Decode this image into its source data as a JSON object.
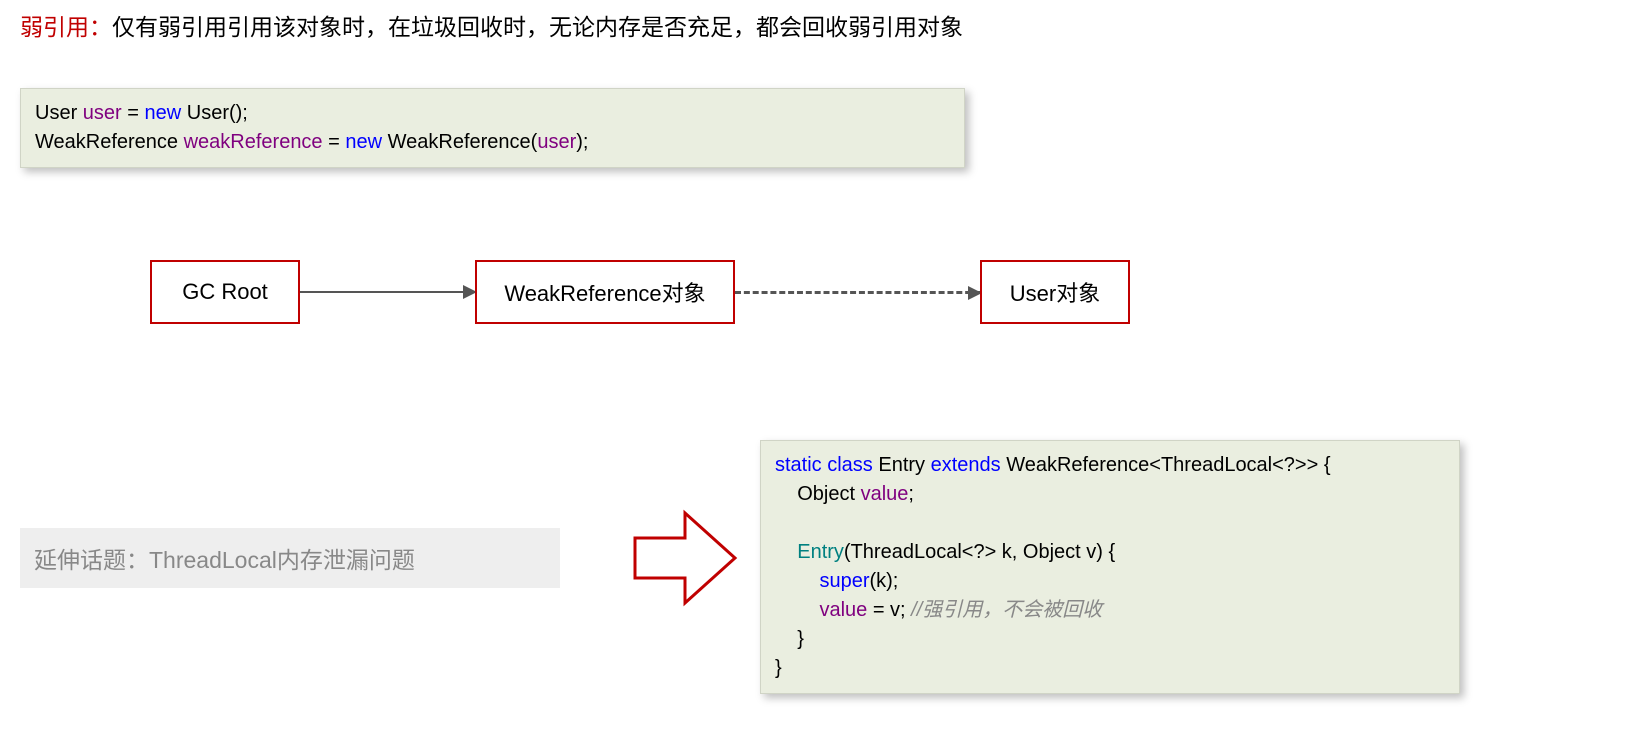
{
  "title": {
    "red": "弱引用：",
    "black": "仅有弱引用引用该对象时，在垃圾回收时，无论内存是否充足，都会回收弱引用对象"
  },
  "code1": {
    "l1": {
      "a": "User ",
      "b": "user",
      "c": " = ",
      "d": "new",
      "e": " User();"
    },
    "l2": {
      "a": "WeakReference ",
      "b": "weakReference",
      "c": " = ",
      "d": "new",
      "e": " WeakReference(",
      "f": "user",
      "g": ");"
    }
  },
  "nodes": {
    "n1": "GC Root",
    "n2": "WeakReference对象",
    "n3": "User对象"
  },
  "topic": "延伸话题：ThreadLocal内存泄漏问题",
  "code2": {
    "l1": {
      "a": "static class",
      "b": " Entry ",
      "c": "extends",
      "d": " WeakReference<ThreadLocal<?>> {"
    },
    "l2": {
      "a": "    Object ",
      "b": "value",
      "c": ";"
    },
    "l3": "",
    "l4": {
      "a": "    ",
      "b": "Entry",
      "c": "(ThreadLocal<?> k, Object v) {"
    },
    "l5": {
      "a": "        ",
      "b": "super",
      "c": "(k);"
    },
    "l6": {
      "a": "        ",
      "b": "value",
      "c": " = v; ",
      "d": "//强引用，不会被回收"
    },
    "l7": "    }",
    "l8": "}"
  }
}
